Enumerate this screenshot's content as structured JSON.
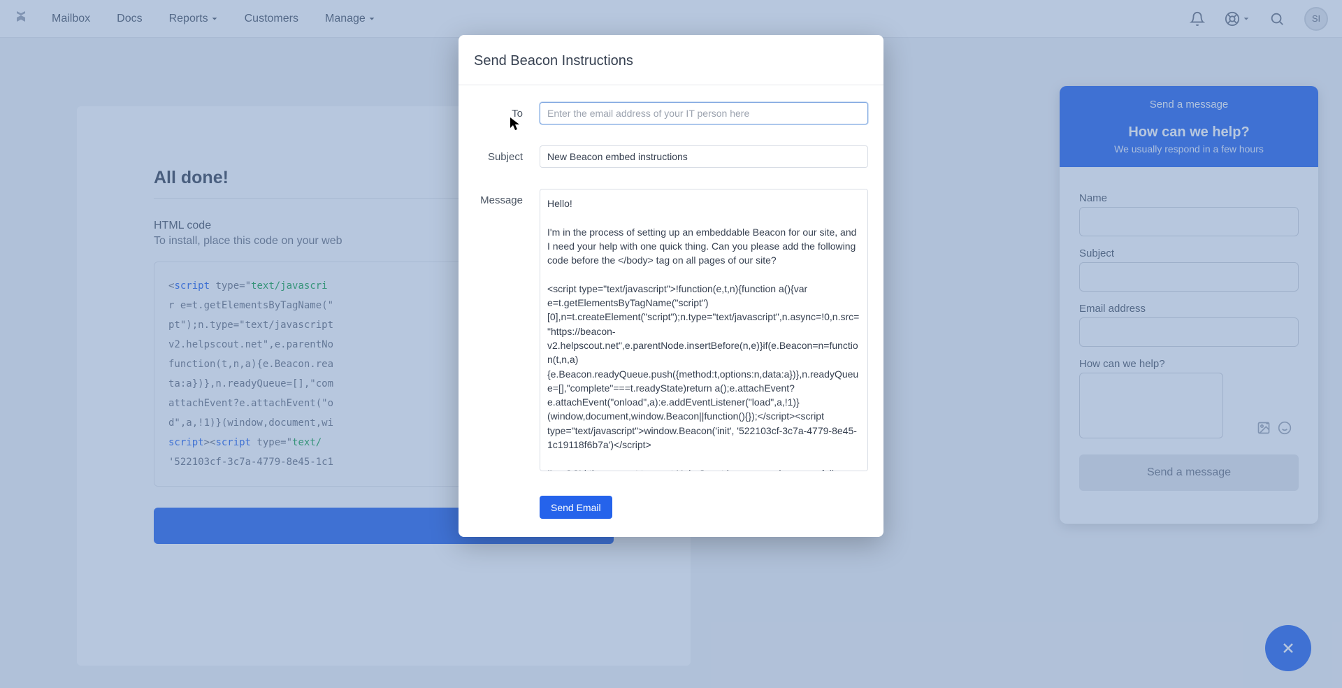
{
  "nav": {
    "items": [
      "Mailbox",
      "Docs",
      "Reports",
      "Customers",
      "Manage"
    ],
    "avatar_initials": "SI"
  },
  "page": {
    "title": "All done!",
    "sub_title": "HTML code",
    "sub_desc_prefix": "To install, place this code on your web",
    "code_lines": [
      {
        "pre": "<",
        "tag": "script",
        "mid": " type=\"",
        "str": "text/javascri"
      },
      {
        "plain": "r e=t.getElementsByTagName(\""
      },
      {
        "plain": "pt\");n.type=\"text/javascript"
      },
      {
        "plain": "v2.helpscout.net\",e.parentNo"
      },
      {
        "plain": "function(t,n,a){e.Beacon.rea"
      },
      {
        "plain": "ta:a})},n.readyQueue=[],\"com"
      },
      {
        "plain": "attachEvent?e.attachEvent(\"o"
      },
      {
        "plain": "d\",a,!1)}(window,document,wi"
      },
      {
        "pre": "</",
        "tag": "script",
        "mid": "><",
        "tag2": "script",
        "mid2": " type=\"",
        "str": "text/"
      },
      {
        "plain": "'522103cf-3c7a-4779-8e45-1c1"
      }
    ]
  },
  "modal": {
    "title": "Send Beacon Instructions",
    "to_label": "To",
    "to_placeholder": "Enter the email address of your IT person here",
    "subject_label": "Subject",
    "subject_value": "New Beacon embed instructions",
    "message_label": "Message",
    "message_value": "Hello!\n\nI'm in the process of setting up an embeddable Beacon for our site, and I need your help with one quick thing. Can you please add the following code before the </body> tag on all pages of our site?\n\n<script type=\"text/javascript\">!function(e,t,n){function a(){var e=t.getElementsByTagName(\"script\")[0],n=t.createElement(\"script\");n.type=\"text/javascript\",n.async=!0,n.src=\"https://beacon-v2.helpscout.net\",e.parentNode.insertBefore(n,e)}if(e.Beacon=n=function(t,n,a){e.Beacon.readyQueue.push({method:t,options:n,data:a})},n.readyQueue=[],\"complete\"===t.readyState)return a();e.attachEvent?e.attachEvent(\"onload\",a):e.addEventListener(\"load\",a,!1)}(window,document,window.Beacon||function(){});</script><script type=\"text/javascript\">window.Beacon('init', '522103cf-3c7a-4779-8e45-1c19118f6b7a')</script>\n\nI've CC'd the support team at Help Scout in case you have any follow-up questions about the Beacon code. Thanks so much!",
    "send_label": "Send Email"
  },
  "widget": {
    "top_link": "Send a message",
    "title": "How can we help?",
    "subtitle": "We usually respond in a few hours",
    "name_label": "Name",
    "subject_label": "Subject",
    "email_label": "Email address",
    "help_label": "How can we help?",
    "send_label": "Send a message"
  }
}
